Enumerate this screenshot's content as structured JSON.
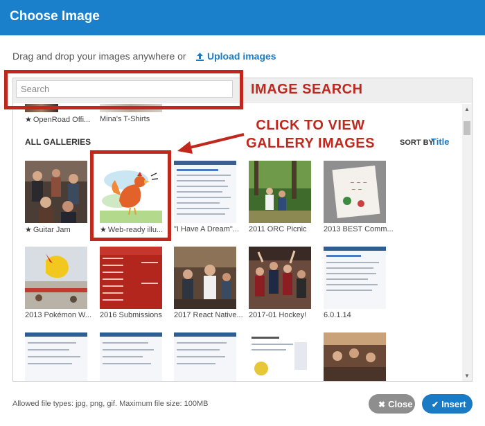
{
  "dialog": {
    "title": "Choose Image",
    "drop_text": "Drag and drop your images anywhere or",
    "upload_label": "Upload images",
    "search": {
      "placeholder": "Search",
      "value": ""
    },
    "annotations": {
      "search": "IMAGE SEARCH",
      "gallery_line1": "CLICK TO VIEW",
      "gallery_line2": "GALLERY IMAGES"
    },
    "starred_galleries": [
      {
        "title": "OpenRoad Offi...",
        "starred": true
      },
      {
        "title": "Mina's T-Shirts",
        "starred": false
      }
    ],
    "section_title": "ALL GALLERIES",
    "sort": {
      "label": "SORT BY",
      "value": "Title"
    },
    "galleries": [
      {
        "title": "Guitar Jam",
        "starred": true
      },
      {
        "title": "Web-ready illu...",
        "starred": true
      },
      {
        "title": "\"I Have A Dream\"...",
        "starred": false
      },
      {
        "title": "2011 ORC Picnic",
        "starred": false
      },
      {
        "title": "2013 BEST Comm...",
        "starred": false
      },
      {
        "title": "2013 Pokémon W...",
        "starred": false
      },
      {
        "title": "2016 Submissions",
        "starred": false
      },
      {
        "title": "2017 React Native...",
        "starred": false
      },
      {
        "title": "2017-01 Hockey!",
        "starred": false
      },
      {
        "title": "6.0.1.14",
        "starred": false
      }
    ],
    "footer_note": "Allowed file types: jpg, png, gif. Maximum file size: 100MB",
    "buttons": {
      "close": "Close",
      "insert": "Insert"
    },
    "colors": {
      "header": "#1a80cc",
      "accent": "#1a7bc4",
      "annotation": "#c0281e",
      "close_button": "#8e8e8e"
    }
  }
}
